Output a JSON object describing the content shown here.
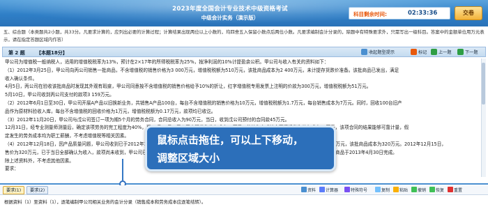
{
  "header": {
    "exam_title": "2023年度全国会计专业技术中级资格考试",
    "exam_subject": "中级会计实务（演示版）",
    "timer_label": "科目剩余时间:",
    "timer_value": "02:33:36",
    "submit_label": "交卷"
  },
  "instructions": {
    "text": "五、综合题（本类题共2小题，共33分。凡要求计算的，应列出必要的计算过程；计算结果出现两位以上小数的，均四舍五入保留小数点后两位小数。凡要求编制会计分录的，除题中有特殊要求外，只需写出一级科目。答案中的金额单位用万元表示，请在指定答题区域内作答）"
  },
  "question_bar": {
    "number": "第 2 题",
    "score": "【本题18分】",
    "buttons": [
      {
        "label": "收起题型提示",
        "icon": "collapse-icon"
      },
      {
        "label": "标记",
        "icon": "flag-icon"
      },
      {
        "label": "上一题",
        "icon": "prev-icon"
      },
      {
        "label": "下一题",
        "icon": "next-icon"
      }
    ]
  },
  "question_body": {
    "lines": [
      "甲公司为增值税一般纳税人，适用的增值税税率为13%，预计在2×17年的所得税税率为25%，按净利润的10%计提盈余公积。甲公司与收入有关的资料如下：",
      "（1）2012年3月25日，甲公司向丙公司销售一批商品，不含增值税的销售价格为3 000万元，增值税税额为510万元，该批商品成本为2 400万元，未计提存货跌价准备。该批商品已发出，满足",
      "收入确认条件。",
      "4月5日，丙公司在验收该批商品时发现其外观有瑕疵，甲公司同意按不含增值税的销售价格给予10%的折让，红字增值税专用发票上注明的价款为300万元，增值税税额为51万元。",
      "5月10日，甲公司收到丙公司支付的款项3 159万元。",
      "（2）2012年6月1日至30日，甲公司开展A产品以旧换新业务，共销售A产品100台，每台不含增值税的销售价格为10万元，增值税税额为1.7万元，每台销售成本为7万元。同时，回收100台旧产",
      "品作为原材料验收入库，每台不含增值税的回收价格为1万元，增值税税额为0.17万元，款项均已收讫。",
      "（3）2012年11月20日，甲公司与戊公司签订一项为期5个月的劳务合同，合同总收入为90万元，当日，收到戊公司预付的合同款45万元。",
      "12月31日，经专业测量师测量后，确定该项劳务的完工程度为40%，至12月31日，甲公司实际发生劳务成本40万元，估计为完成该合同还将发生劳务成本40万元，该项合同的结果能够可靠计量，假",
      "定发生的劳务成本均为职工薪酬，不考虑增值税等相关因素。",
      "（4）2012年12月18日，因产品质量问题，甲公司收到已于2012年12月20日将销售给庚公司的一批W产品退回，该批产品销售价格为500万元，增值税税额为85万元，该批商品成本为320万元。2012年12月15日，",
      "售价为320万元，已于当日全部确认为收入，款项尚未收到，甲公司已对该批产品计提坏账准备，W商品在检验中发现质量问题退货，甲公司同意庚公司退货，该批商品于2013年4月30日完成。",
      "除上述资料外，不考虑其他因素。",
      "要求："
    ]
  },
  "tooltip": {
    "line1": "鼠标点击拖住，可以上下移动，",
    "line2": "调整区域大小"
  },
  "tabs": [
    {
      "label": "要求(1)",
      "active": true
    },
    {
      "label": "要求(2)",
      "active": false
    }
  ],
  "toolbar": [
    {
      "label": "资料",
      "icon": "material-icon"
    },
    {
      "label": "计算器",
      "icon": "calculator-icon"
    },
    {
      "label": "特殊符号",
      "icon": "symbol-icon"
    },
    {
      "label": "复制",
      "icon": "copy-icon"
    },
    {
      "label": "粘贴",
      "icon": "paste-icon"
    },
    {
      "label": "撤销",
      "icon": "undo-icon"
    },
    {
      "label": "恢复",
      "icon": "redo-icon"
    },
    {
      "label": "重置",
      "icon": "reset-icon"
    }
  ],
  "answer_area": {
    "text": "根据资料（1）至资料（1），逐笔编制甲公司相关业务的会计分录（销售成本和劳务成本应逐笔结转）。"
  },
  "colors": {
    "header_blue": "#2f7fc7",
    "timer_orange": "#e8590c",
    "tooltip_blue": "#2c6fba",
    "splitter_blue": "#4a8fd0"
  }
}
